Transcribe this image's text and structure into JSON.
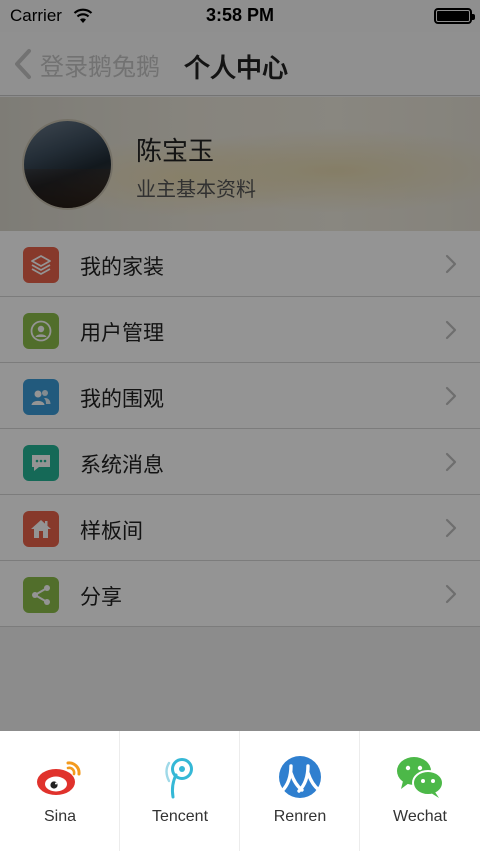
{
  "status_bar": {
    "carrier": "Carrier",
    "time": "3:58 PM"
  },
  "nav": {
    "back_label": "登录鹅兔鹅",
    "title": "个人中心"
  },
  "profile": {
    "name": "陈宝玉",
    "subtitle": "业主基本资料"
  },
  "menu": {
    "items": [
      {
        "label": "我的家装",
        "icon": "layers-icon",
        "color": "#e8624a"
      },
      {
        "label": "用户管理",
        "icon": "user-icon",
        "color": "#8cbd4a"
      },
      {
        "label": "我的围观",
        "icon": "group-icon",
        "color": "#3b9bd8"
      },
      {
        "label": "系统消息",
        "icon": "message-icon",
        "color": "#25b596"
      },
      {
        "label": "样板间",
        "icon": "home-icon",
        "color": "#e8624a"
      },
      {
        "label": "分享",
        "icon": "share-icon",
        "color": "#8cbd4a"
      }
    ]
  },
  "share_sheet": {
    "items": [
      {
        "label": "Sina",
        "icon": "sina-weibo-icon",
        "color": "#e0322c"
      },
      {
        "label": "Tencent",
        "icon": "tencent-weibo-icon",
        "color": "#35b8d6"
      },
      {
        "label": "Renren",
        "icon": "renren-icon",
        "color": "#2f7fcf"
      },
      {
        "label": "Wechat",
        "icon": "wechat-icon",
        "color": "#4cb848"
      }
    ]
  },
  "overlay_color": "rgba(0,0,0,0.42)"
}
